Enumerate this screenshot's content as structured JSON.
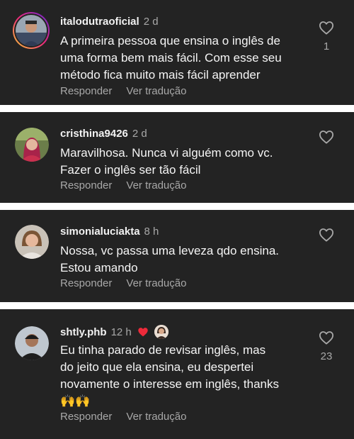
{
  "comments": [
    {
      "username": "italodutraoficial",
      "time": "2 d",
      "lines": [
        "A primeira pessoa que ensina o inglês de",
        "uma forma bem mais fácil. Com esse seu",
        "método fica muito mais fácil aprender"
      ],
      "like_count": "1",
      "reply_label": "Responder",
      "translate_label": "Ver tradução"
    },
    {
      "username": "cristhina9426",
      "time": "2 d",
      "lines": [
        "Maravilhosa. Nunca vi alguém como vc.",
        "Fazer o inglês ser tão fácil"
      ],
      "like_count": "",
      "reply_label": "Responder",
      "translate_label": "Ver tradução"
    },
    {
      "username": "simonialuciakta",
      "time": "8 h",
      "lines": [
        "Nossa, vc passa uma leveza qdo ensina.",
        "Estou amando"
      ],
      "like_count": "",
      "reply_label": "Responder",
      "translate_label": "Ver tradução"
    },
    {
      "username": "shtly.phb",
      "time": "12 h",
      "lines": [
        "Eu tinha parado de revisar inglês, mas",
        "do jeito que ela ensina, eu despertei",
        "novamente o interesse em inglês, thanks",
        "🙌🙌"
      ],
      "like_count": "23",
      "reply_label": "Responder",
      "translate_label": "Ver tradução"
    }
  ],
  "colors": {
    "card_bg": "#232323",
    "separator": "#ffffff",
    "text_primary": "#f5f5f5",
    "text_secondary": "#a8a8a8",
    "creator_heart": "#ed2a3a"
  },
  "icons": {
    "like": "heart-outline-icon",
    "creator_like": "heart-filled-icon"
  }
}
